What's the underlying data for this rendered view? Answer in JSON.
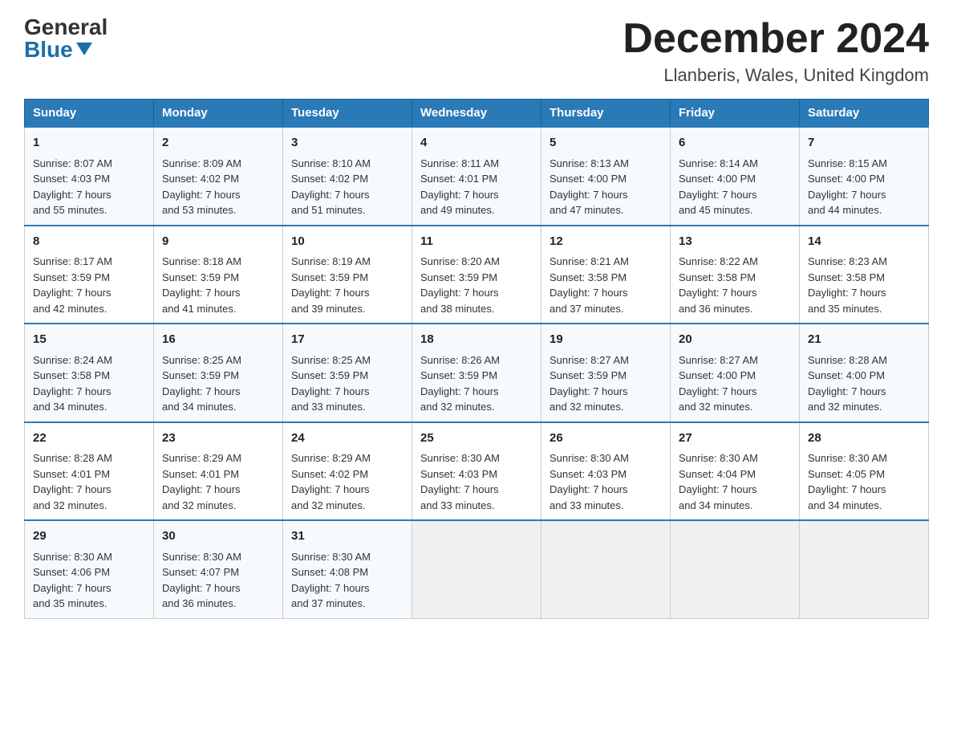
{
  "header": {
    "logo_general": "General",
    "logo_blue": "Blue",
    "month_title": "December 2024",
    "location": "Llanberis, Wales, United Kingdom"
  },
  "days_of_week": [
    "Sunday",
    "Monday",
    "Tuesday",
    "Wednesday",
    "Thursday",
    "Friday",
    "Saturday"
  ],
  "weeks": [
    [
      {
        "day": "1",
        "sunrise": "8:07 AM",
        "sunset": "4:03 PM",
        "daylight": "7 hours and 55 minutes."
      },
      {
        "day": "2",
        "sunrise": "8:09 AM",
        "sunset": "4:02 PM",
        "daylight": "7 hours and 53 minutes."
      },
      {
        "day": "3",
        "sunrise": "8:10 AM",
        "sunset": "4:02 PM",
        "daylight": "7 hours and 51 minutes."
      },
      {
        "day": "4",
        "sunrise": "8:11 AM",
        "sunset": "4:01 PM",
        "daylight": "7 hours and 49 minutes."
      },
      {
        "day": "5",
        "sunrise": "8:13 AM",
        "sunset": "4:00 PM",
        "daylight": "7 hours and 47 minutes."
      },
      {
        "day": "6",
        "sunrise": "8:14 AM",
        "sunset": "4:00 PM",
        "daylight": "7 hours and 45 minutes."
      },
      {
        "day": "7",
        "sunrise": "8:15 AM",
        "sunset": "4:00 PM",
        "daylight": "7 hours and 44 minutes."
      }
    ],
    [
      {
        "day": "8",
        "sunrise": "8:17 AM",
        "sunset": "3:59 PM",
        "daylight": "7 hours and 42 minutes."
      },
      {
        "day": "9",
        "sunrise": "8:18 AM",
        "sunset": "3:59 PM",
        "daylight": "7 hours and 41 minutes."
      },
      {
        "day": "10",
        "sunrise": "8:19 AM",
        "sunset": "3:59 PM",
        "daylight": "7 hours and 39 minutes."
      },
      {
        "day": "11",
        "sunrise": "8:20 AM",
        "sunset": "3:59 PM",
        "daylight": "7 hours and 38 minutes."
      },
      {
        "day": "12",
        "sunrise": "8:21 AM",
        "sunset": "3:58 PM",
        "daylight": "7 hours and 37 minutes."
      },
      {
        "day": "13",
        "sunrise": "8:22 AM",
        "sunset": "3:58 PM",
        "daylight": "7 hours and 36 minutes."
      },
      {
        "day": "14",
        "sunrise": "8:23 AM",
        "sunset": "3:58 PM",
        "daylight": "7 hours and 35 minutes."
      }
    ],
    [
      {
        "day": "15",
        "sunrise": "8:24 AM",
        "sunset": "3:58 PM",
        "daylight": "7 hours and 34 minutes."
      },
      {
        "day": "16",
        "sunrise": "8:25 AM",
        "sunset": "3:59 PM",
        "daylight": "7 hours and 34 minutes."
      },
      {
        "day": "17",
        "sunrise": "8:25 AM",
        "sunset": "3:59 PM",
        "daylight": "7 hours and 33 minutes."
      },
      {
        "day": "18",
        "sunrise": "8:26 AM",
        "sunset": "3:59 PM",
        "daylight": "7 hours and 32 minutes."
      },
      {
        "day": "19",
        "sunrise": "8:27 AM",
        "sunset": "3:59 PM",
        "daylight": "7 hours and 32 minutes."
      },
      {
        "day": "20",
        "sunrise": "8:27 AM",
        "sunset": "4:00 PM",
        "daylight": "7 hours and 32 minutes."
      },
      {
        "day": "21",
        "sunrise": "8:28 AM",
        "sunset": "4:00 PM",
        "daylight": "7 hours and 32 minutes."
      }
    ],
    [
      {
        "day": "22",
        "sunrise": "8:28 AM",
        "sunset": "4:01 PM",
        "daylight": "7 hours and 32 minutes."
      },
      {
        "day": "23",
        "sunrise": "8:29 AM",
        "sunset": "4:01 PM",
        "daylight": "7 hours and 32 minutes."
      },
      {
        "day": "24",
        "sunrise": "8:29 AM",
        "sunset": "4:02 PM",
        "daylight": "7 hours and 32 minutes."
      },
      {
        "day": "25",
        "sunrise": "8:30 AM",
        "sunset": "4:03 PM",
        "daylight": "7 hours and 33 minutes."
      },
      {
        "day": "26",
        "sunrise": "8:30 AM",
        "sunset": "4:03 PM",
        "daylight": "7 hours and 33 minutes."
      },
      {
        "day": "27",
        "sunrise": "8:30 AM",
        "sunset": "4:04 PM",
        "daylight": "7 hours and 34 minutes."
      },
      {
        "day": "28",
        "sunrise": "8:30 AM",
        "sunset": "4:05 PM",
        "daylight": "7 hours and 34 minutes."
      }
    ],
    [
      {
        "day": "29",
        "sunrise": "8:30 AM",
        "sunset": "4:06 PM",
        "daylight": "7 hours and 35 minutes."
      },
      {
        "day": "30",
        "sunrise": "8:30 AM",
        "sunset": "4:07 PM",
        "daylight": "7 hours and 36 minutes."
      },
      {
        "day": "31",
        "sunrise": "8:30 AM",
        "sunset": "4:08 PM",
        "daylight": "7 hours and 37 minutes."
      },
      null,
      null,
      null,
      null
    ]
  ],
  "labels": {
    "sunrise": "Sunrise:",
    "sunset": "Sunset:",
    "daylight": "Daylight:"
  }
}
